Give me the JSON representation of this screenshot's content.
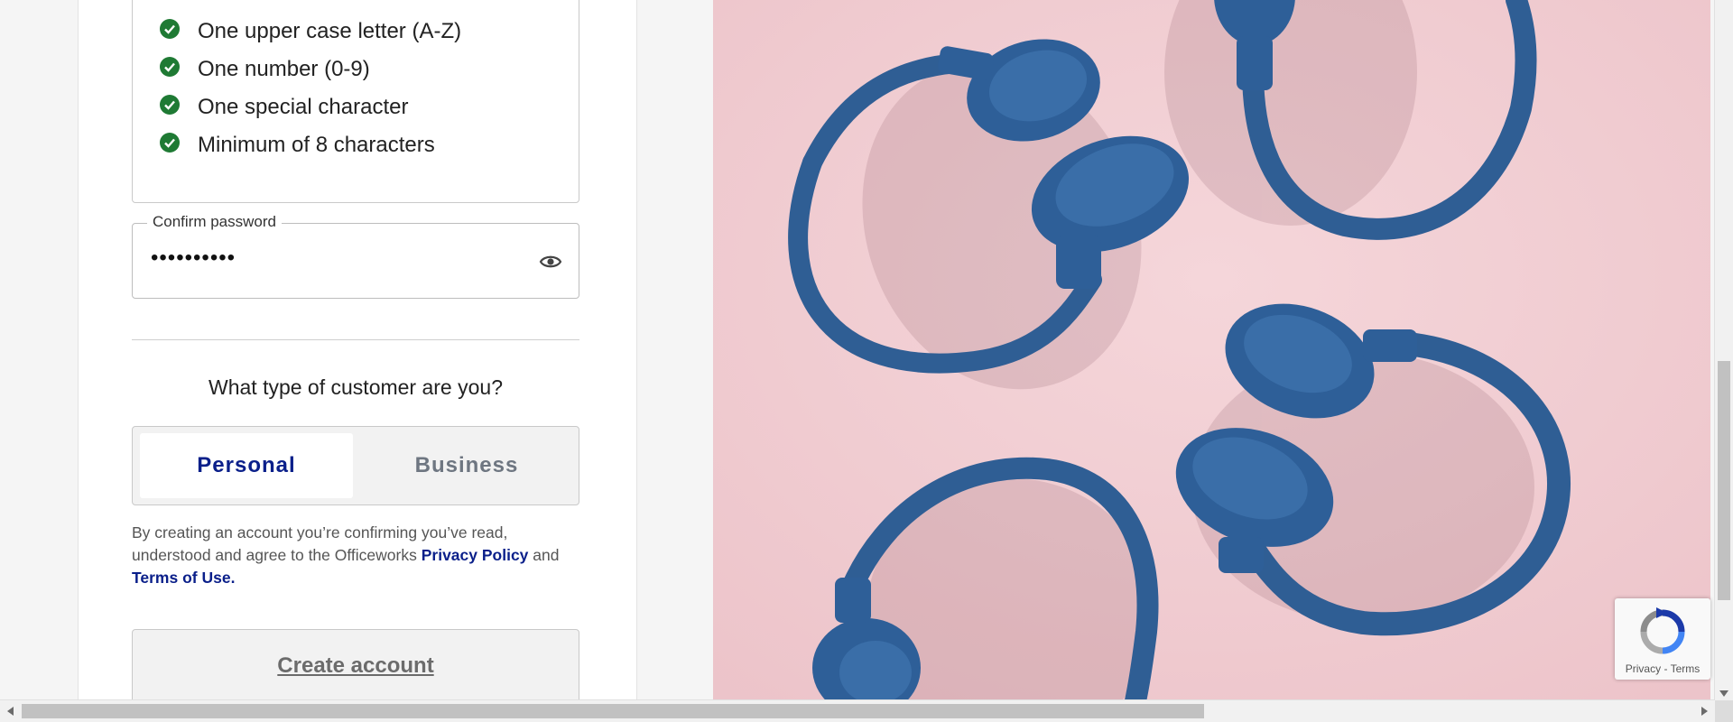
{
  "requirements": [
    {
      "label": "One upper case letter (A-Z)",
      "met": true
    },
    {
      "label": "One number (0-9)",
      "met": true
    },
    {
      "label": "One special character",
      "met": true
    },
    {
      "label": "Minimum of 8 characters",
      "met": true
    }
  ],
  "confirm_password": {
    "label": "Confirm password",
    "value": "••••••••••",
    "toggle_icon": "eye-icon"
  },
  "customer_type": {
    "question": "What type of customer are you?",
    "options": [
      "Personal",
      "Business"
    ],
    "selected": "Personal"
  },
  "legal": {
    "text_before": "By creating an account you’re confirming you’ve read, understood and agree to the Officeworks ",
    "privacy_link": "Privacy Policy",
    "and": " and ",
    "terms_link": "Terms of Use."
  },
  "create_account_label": "Create account",
  "recaptcha": {
    "privacy": "Privacy",
    "separator": "-",
    "terms": "Terms"
  },
  "colors": {
    "check_green": "#1f7a34",
    "brand_blue": "#0a1f8a",
    "photo_pink": "#f1cfd4",
    "headphone_blue": "#2f5e94"
  }
}
